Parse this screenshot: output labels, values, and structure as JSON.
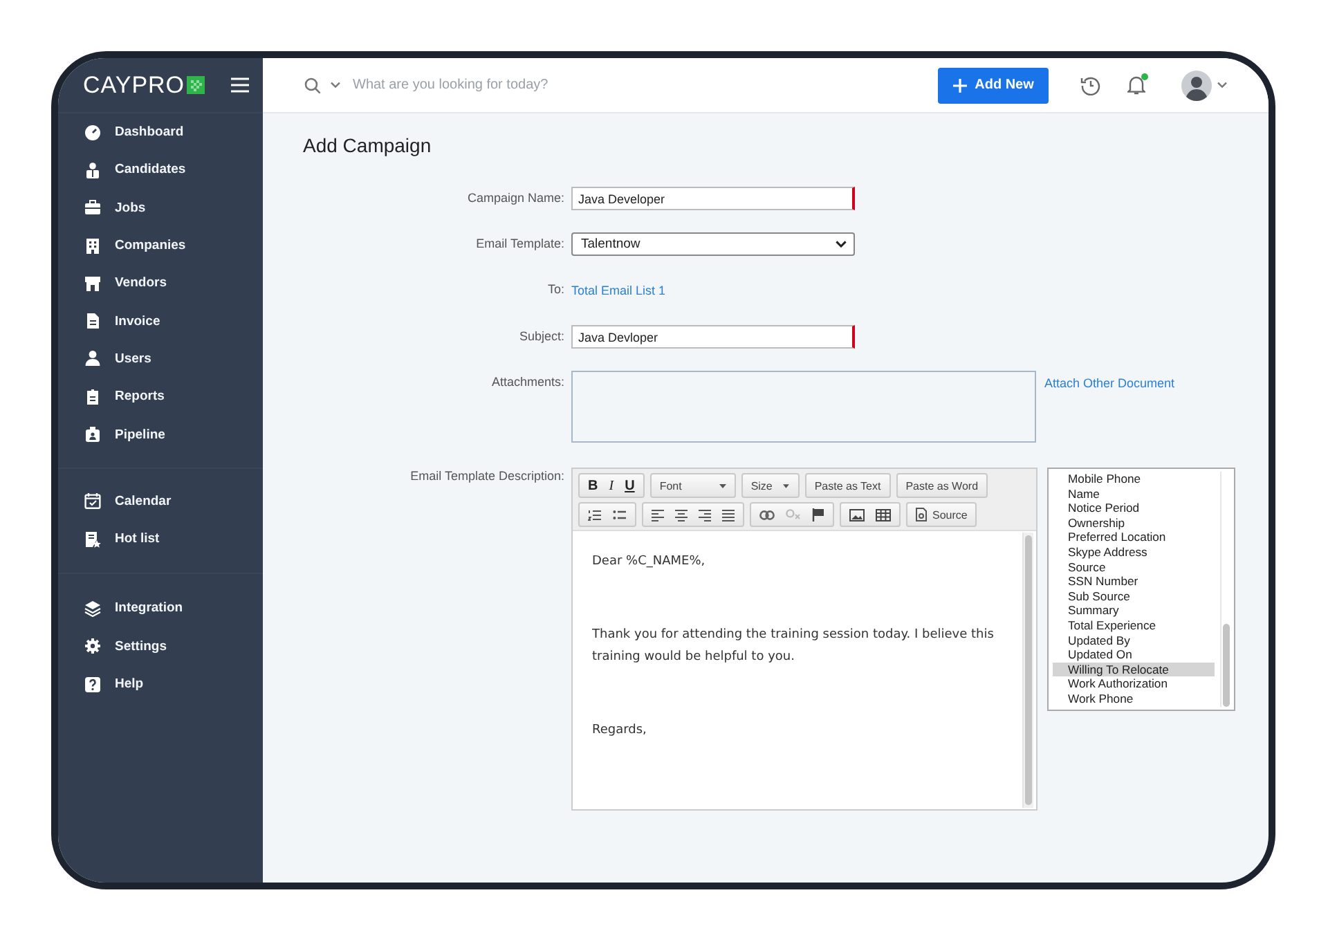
{
  "brand": {
    "name": "CAYPRO"
  },
  "sidebar": {
    "groups": [
      {
        "items": [
          {
            "label": "Dashboard"
          },
          {
            "label": "Candidates"
          },
          {
            "label": "Jobs"
          },
          {
            "label": "Companies"
          },
          {
            "label": "Vendors"
          },
          {
            "label": "Invoice"
          },
          {
            "label": "Users"
          },
          {
            "label": "Reports"
          },
          {
            "label": "Pipeline"
          }
        ]
      },
      {
        "items": [
          {
            "label": "Calendar"
          },
          {
            "label": "Hot list"
          }
        ]
      },
      {
        "items": [
          {
            "label": "Integration"
          },
          {
            "label": "Settings"
          },
          {
            "label": "Help"
          }
        ]
      }
    ]
  },
  "topbar": {
    "search": {
      "placeholder": "What are you looking for today?"
    },
    "add_button": "Add New",
    "notifications": {
      "unread": true
    }
  },
  "page": {
    "title": "Add Campaign"
  },
  "form": {
    "fields": [
      {
        "kind": "text",
        "label": "Campaign Name:",
        "value": "Java Developer",
        "required": true
      },
      {
        "kind": "select",
        "label": "Email Template:",
        "value": "Talentnow"
      },
      {
        "kind": "link",
        "label": "To:",
        "value": "Total Email List 1"
      },
      {
        "kind": "text",
        "label": "Subject:",
        "value": "Java Devloper",
        "required": true
      },
      {
        "kind": "attachments",
        "label": "Attachments:",
        "link": "Attach Other Document"
      },
      {
        "kind": "editor",
        "label": "Email Template Description:"
      }
    ]
  },
  "editor": {
    "toolbar": {
      "format": [
        "B",
        "I",
        "U"
      ],
      "dropdowns": [
        "Font",
        "Size"
      ],
      "paste": [
        "Paste as Text",
        "Paste as Word"
      ],
      "source": "Source"
    },
    "paragraphs": [
      "Dear %C_NAME%,",
      "Thank you for attending the training session today. I believe this training would be helpful to you.",
      "Regards,"
    ]
  },
  "merge_fields": [
    {
      "label": "Mobile Phone",
      "selected": false
    },
    {
      "label": "Name",
      "selected": false
    },
    {
      "label": "Notice Period",
      "selected": false
    },
    {
      "label": "Ownership",
      "selected": false
    },
    {
      "label": "Preferred Location",
      "selected": false
    },
    {
      "label": "Skype Address",
      "selected": false
    },
    {
      "label": "Source",
      "selected": false
    },
    {
      "label": "SSN Number",
      "selected": false
    },
    {
      "label": "Sub Source",
      "selected": false
    },
    {
      "label": "Summary",
      "selected": false
    },
    {
      "label": "Total Experience",
      "selected": false
    },
    {
      "label": "Updated By",
      "selected": false
    },
    {
      "label": "Updated On",
      "selected": false
    },
    {
      "label": "Willing To Relocate",
      "selected": true
    },
    {
      "label": "Work Authorization",
      "selected": false
    },
    {
      "label": "Work Phone",
      "selected": false
    }
  ]
}
